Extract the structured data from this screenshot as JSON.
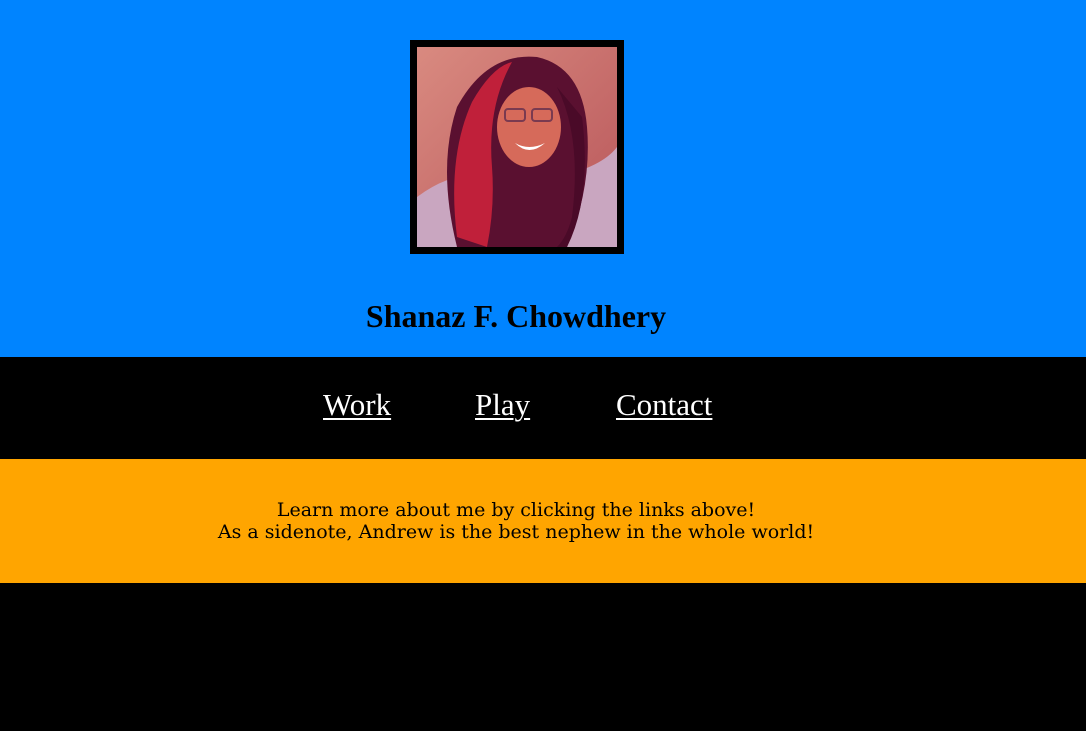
{
  "header": {
    "title": "Shanaz F. Chowdhery",
    "background_color": "#0084FF",
    "avatar_icon": "profile-photo"
  },
  "nav": {
    "background_color": "#000000",
    "items": [
      {
        "label": "Work"
      },
      {
        "label": "Play"
      },
      {
        "label": "Contact"
      }
    ]
  },
  "intro": {
    "background_color": "#FFA500",
    "line1": "Learn more about me by clicking the links above!",
    "line2": "As a sidenote, Andrew is the best nephew in the whole world!"
  }
}
